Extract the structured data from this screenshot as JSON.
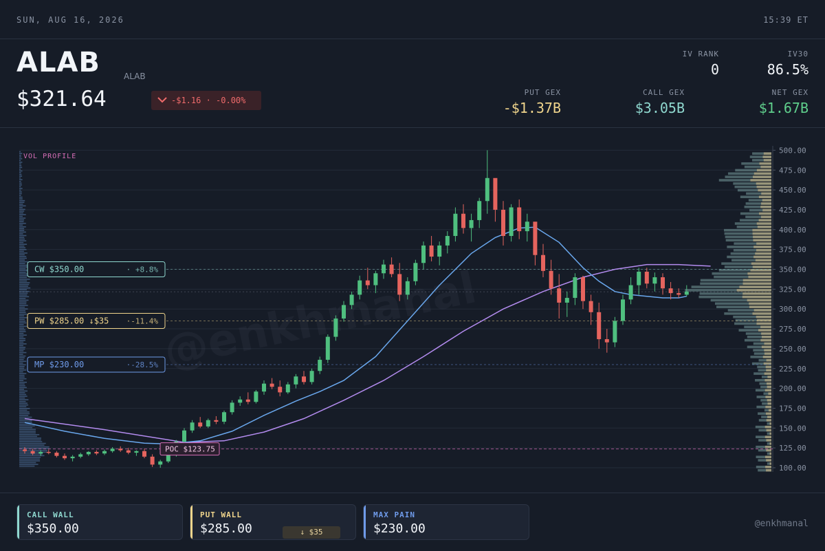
{
  "topbar": {
    "date": "SUN, AUG 16, 2026",
    "time": "15:39 ET"
  },
  "header": {
    "ticker": "ALAB",
    "ticker_sub": "ALAB",
    "price": "$321.64",
    "change": "-$1.16 · -0.00%",
    "change_icon": "chevron-down-icon",
    "stats": {
      "iv_rank_label": "IV RANK",
      "iv_rank": "0",
      "iv30_label": "IV30",
      "iv30": "86.5%",
      "put_gex_label": "PUT GEX",
      "put_gex": "-$1.37B",
      "call_gex_label": "CALL GEX",
      "call_gex": "$3.05B",
      "net_gex_label": "NET GEX",
      "net_gex": "$1.67B"
    }
  },
  "colors": {
    "up": "#4fbf7f",
    "down": "#e5645e",
    "call": "#8fd8cf",
    "put": "#f0d58c",
    "maxpain": "#6f9bea",
    "poc": "#d86fb8",
    "ma_fast": "#6aa8ee",
    "ma_slow": "#b48cf0"
  },
  "chart_data": {
    "type": "candlestick",
    "vol_profile_label": "VOL PROFILE",
    "y_ticks": [
      "500.00",
      "475.00",
      "450.00",
      "425.00",
      "400.00",
      "375.00",
      "350.00",
      "325.00",
      "300.00",
      "275.00",
      "250.00",
      "225.00",
      "200.00",
      "175.00",
      "150.00",
      "125.00",
      "100.00"
    ],
    "ylim": [
      100,
      500
    ],
    "levels": [
      {
        "key": "cw",
        "label": "CW $350.00",
        "pct": "· +8.8%",
        "value": 350
      },
      {
        "key": "pw",
        "label": "PW $285.00 ↓$35",
        "pct": "·-11.4%",
        "value": 285
      },
      {
        "key": "mp",
        "label": "MP $230.00",
        "pct": "·-28.5%",
        "value": 230
      }
    ],
    "poc": {
      "label": "POC $123.75",
      "value": 123.75
    },
    "last": 321.64,
    "candles": [
      [
        123,
        126,
        118,
        121
      ],
      [
        121,
        124,
        116,
        118
      ],
      [
        118,
        122,
        115,
        120
      ],
      [
        120,
        123,
        117,
        119
      ],
      [
        119,
        121,
        113,
        115
      ],
      [
        115,
        118,
        110,
        112
      ],
      [
        112,
        116,
        108,
        114
      ],
      [
        114,
        119,
        112,
        117
      ],
      [
        117,
        121,
        115,
        120
      ],
      [
        120,
        122,
        116,
        118
      ],
      [
        118,
        123,
        116,
        121
      ],
      [
        121,
        126,
        119,
        124
      ],
      [
        124,
        127,
        120,
        122
      ],
      [
        122,
        125,
        117,
        119
      ],
      [
        119,
        122,
        115,
        121
      ],
      [
        121,
        124,
        112,
        114
      ],
      [
        114,
        117,
        101,
        104
      ],
      [
        104,
        110,
        100,
        108
      ],
      [
        108,
        118,
        106,
        116
      ],
      [
        116,
        135,
        114,
        133
      ],
      [
        133,
        150,
        130,
        147
      ],
      [
        147,
        160,
        144,
        157
      ],
      [
        157,
        164,
        150,
        152
      ],
      [
        152,
        162,
        150,
        160
      ],
      [
        160,
        165,
        155,
        158
      ],
      [
        158,
        172,
        155,
        170
      ],
      [
        170,
        185,
        167,
        182
      ],
      [
        182,
        190,
        178,
        186
      ],
      [
        186,
        195,
        180,
        183
      ],
      [
        183,
        198,
        181,
        196
      ],
      [
        196,
        210,
        192,
        206
      ],
      [
        206,
        213,
        199,
        202
      ],
      [
        202,
        210,
        190,
        195
      ],
      [
        195,
        208,
        193,
        205
      ],
      [
        205,
        218,
        200,
        215
      ],
      [
        215,
        222,
        205,
        208
      ],
      [
        208,
        225,
        205,
        222
      ],
      [
        222,
        240,
        218,
        236
      ],
      [
        236,
        268,
        232,
        265
      ],
      [
        265,
        292,
        260,
        288
      ],
      [
        288,
        310,
        284,
        305
      ],
      [
        305,
        322,
        300,
        318
      ],
      [
        318,
        342,
        312,
        336
      ],
      [
        336,
        352,
        325,
        330
      ],
      [
        330,
        348,
        320,
        345
      ],
      [
        345,
        362,
        338,
        356
      ],
      [
        356,
        365,
        340,
        344
      ],
      [
        344,
        358,
        310,
        318
      ],
      [
        318,
        340,
        312,
        335
      ],
      [
        335,
        362,
        330,
        358
      ],
      [
        358,
        385,
        350,
        380
      ],
      [
        380,
        392,
        360,
        366
      ],
      [
        366,
        385,
        355,
        380
      ],
      [
        380,
        398,
        370,
        392
      ],
      [
        392,
        428,
        385,
        420
      ],
      [
        420,
        432,
        395,
        402
      ],
      [
        402,
        420,
        385,
        412
      ],
      [
        412,
        440,
        402,
        436
      ],
      [
        436,
        500,
        420,
        465
      ],
      [
        465,
        458,
        410,
        425
      ],
      [
        425,
        436,
        380,
        392
      ],
      [
        392,
        432,
        385,
        428
      ],
      [
        428,
        438,
        388,
        398
      ],
      [
        398,
        420,
        385,
        410
      ],
      [
        410,
        402,
        355,
        368
      ],
      [
        368,
        382,
        340,
        348
      ],
      [
        348,
        362,
        318,
        326
      ],
      [
        326,
        344,
        288,
        308
      ],
      [
        308,
        322,
        290,
        314
      ],
      [
        314,
        345,
        305,
        340
      ],
      [
        340,
        342,
        300,
        310
      ],
      [
        310,
        318,
        280,
        296
      ],
      [
        296,
        308,
        250,
        262
      ],
      [
        262,
        275,
        245,
        258
      ],
      [
        258,
        290,
        252,
        285
      ],
      [
        285,
        318,
        280,
        312
      ],
      [
        312,
        340,
        306,
        330
      ],
      [
        330,
        352,
        318,
        347
      ],
      [
        347,
        352,
        326,
        332
      ],
      [
        332,
        346,
        322,
        340
      ],
      [
        340,
        345,
        318,
        326
      ],
      [
        326,
        334,
        312,
        320
      ],
      [
        320,
        326,
        314,
        318
      ],
      [
        318,
        330,
        316,
        322
      ]
    ],
    "ma_fast": [
      [
        0,
        157
      ],
      [
        5,
        146
      ],
      [
        10,
        137
      ],
      [
        15,
        131
      ],
      [
        18,
        130
      ],
      [
        22,
        134
      ],
      [
        26,
        146
      ],
      [
        30,
        166
      ],
      [
        34,
        184
      ],
      [
        37,
        196
      ],
      [
        40,
        210
      ],
      [
        44,
        240
      ],
      [
        48,
        285
      ],
      [
        52,
        330
      ],
      [
        56,
        370
      ],
      [
        59,
        390
      ],
      [
        62,
        402
      ],
      [
        64,
        403
      ],
      [
        67,
        384
      ],
      [
        70,
        352
      ],
      [
        72,
        335
      ],
      [
        74,
        322
      ],
      [
        76,
        318
      ],
      [
        78,
        316
      ],
      [
        80,
        314
      ],
      [
        82,
        314
      ],
      [
        83,
        316
      ]
    ],
    "ma_slow": [
      [
        0,
        162
      ],
      [
        10,
        148
      ],
      [
        20,
        132
      ],
      [
        25,
        134
      ],
      [
        30,
        145
      ],
      [
        35,
        162
      ],
      [
        40,
        185
      ],
      [
        45,
        210
      ],
      [
        50,
        240
      ],
      [
        55,
        272
      ],
      [
        60,
        300
      ],
      [
        65,
        322
      ],
      [
        70,
        340
      ],
      [
        74,
        350
      ],
      [
        78,
        356
      ],
      [
        82,
        356
      ],
      [
        86,
        354
      ]
    ],
    "watermark": "@enkhmanal"
  },
  "footer": {
    "call_wall_label": "CALL WALL",
    "call_wall": "$350.00",
    "put_wall_label": "PUT WALL",
    "put_wall": "$285.00",
    "put_wall_badge": "↓ $35",
    "max_pain_label": "MAX PAIN",
    "max_pain": "$230.00",
    "handle": "@enkhmanal"
  }
}
